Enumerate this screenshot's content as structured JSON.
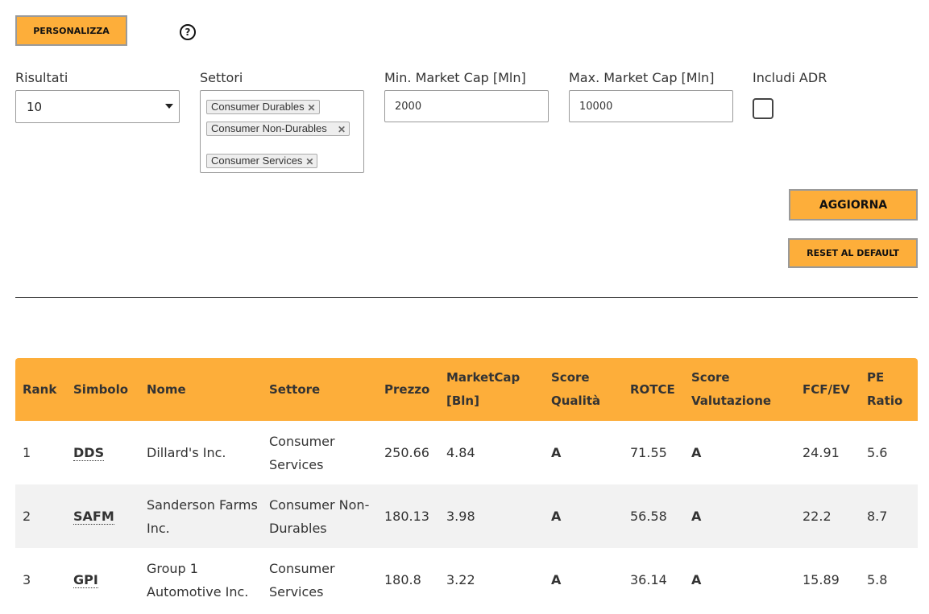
{
  "toolbar": {
    "personalizza_label": "PERSONALIZZA",
    "help_symbol": "?"
  },
  "filters": {
    "risultati": {
      "label": "Risultati",
      "value": "10"
    },
    "settori": {
      "label": "Settori",
      "tags": [
        "Consumer Durables",
        "Consumer Non-Durables",
        "Consumer Services"
      ]
    },
    "min_cap": {
      "label": "Min. Market Cap [Mln]",
      "value": "2000"
    },
    "max_cap": {
      "label": "Max. Market Cap [Mln]",
      "value": "10000"
    },
    "adr": {
      "label": "Includi ADR",
      "checked": false
    }
  },
  "actions": {
    "aggiorna_label": "AGGIORNA",
    "reset_label": "RESET AL DEFAULT"
  },
  "table": {
    "headers": [
      "Rank",
      "Simbolo",
      "Nome",
      "Settore",
      "Prezzo",
      "MarketCap [Bln]",
      "Score Qualità",
      "ROTCE",
      "Score Valutazione",
      "FCF/EV",
      "PE Ratio"
    ],
    "rows": [
      {
        "rank": "1",
        "symbol": "DDS",
        "name": "Dillard's Inc.",
        "sector": "Consumer Services",
        "price": "250.66",
        "mcap": "4.84",
        "quality": "A",
        "rotce": "71.55",
        "valuation": "A",
        "fcfev": "24.91",
        "pe": "5.6"
      },
      {
        "rank": "2",
        "symbol": "SAFM",
        "name": "Sanderson Farms Inc.",
        "sector": "Consumer Non-Durables",
        "price": "180.13",
        "mcap": "3.98",
        "quality": "A",
        "rotce": "56.58",
        "valuation": "A",
        "fcfev": "22.2",
        "pe": "8.7"
      },
      {
        "rank": "3",
        "symbol": "GPI",
        "name": "Group 1 Automotive Inc.",
        "sector": "Consumer Services",
        "price": "180.8",
        "mcap": "3.22",
        "quality": "A",
        "rotce": "36.14",
        "valuation": "A",
        "fcfev": "15.89",
        "pe": "5.8"
      }
    ]
  },
  "colors": {
    "accent": "#fdae3a",
    "row_alt": "#f2f2f2"
  },
  "icons": {
    "help": "help-circle-icon",
    "remove_tag": "close-icon",
    "dropdown": "chevron-down-icon"
  }
}
